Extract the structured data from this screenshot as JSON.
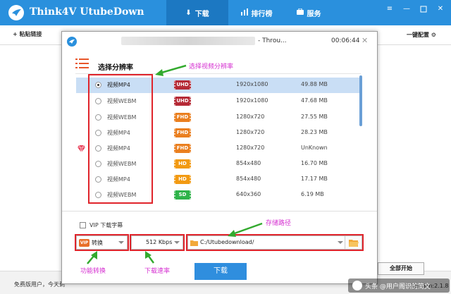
{
  "app": {
    "title": "Think4V UtubeDown"
  },
  "nav": {
    "tabs": [
      {
        "label": "下载",
        "icon": "download-arrow-icon",
        "active": true
      },
      {
        "label": "排行榜",
        "icon": "bar-chart-icon",
        "active": false
      },
      {
        "label": "服务",
        "icon": "briefcase-icon",
        "active": false
      }
    ]
  },
  "window_controls": {
    "menu": "≡",
    "minimize": "—",
    "close": "✕"
  },
  "main": {
    "paste_link": "+ 粘贴链接",
    "settings": "一键配置 ⚙",
    "free_user_text": "免费版用户，今天剩",
    "start_all": "全部开始",
    "version": "Version:2.1.8"
  },
  "dialog": {
    "title_suffix": "- Throu...",
    "duration": "00:06:44",
    "close": "✕",
    "section_title": "选择分辨率",
    "rows": [
      {
        "format": "视频MP4",
        "quality": "UHD",
        "resolution": "1920x1080",
        "size": "49.88 MB",
        "selected": true,
        "vip": false
      },
      {
        "format": "视频WEBM",
        "quality": "UHD",
        "resolution": "1920x1080",
        "size": "47.68 MB",
        "selected": false,
        "vip": false
      },
      {
        "format": "视频WEBM",
        "quality": "FHD",
        "resolution": "1280x720",
        "size": "27.55 MB",
        "selected": false,
        "vip": false
      },
      {
        "format": "视频MP4",
        "quality": "FHD",
        "resolution": "1280x720",
        "size": "28.23 MB",
        "selected": false,
        "vip": false
      },
      {
        "format": "视频MP4",
        "quality": "FHD",
        "resolution": "1280x720",
        "size": "UnKnown",
        "selected": false,
        "vip": true
      },
      {
        "format": "视频WEBM",
        "quality": "HD",
        "resolution": "854x480",
        "size": "16.70 MB",
        "selected": false,
        "vip": false
      },
      {
        "format": "视频MP4",
        "quality": "HD",
        "resolution": "854x480",
        "size": "17.17 MB",
        "selected": false,
        "vip": false
      },
      {
        "format": "视频WEBM",
        "quality": "SD",
        "resolution": "640x360",
        "size": "6.19 MB",
        "selected": false,
        "vip": false
      }
    ],
    "vip_subtitle_label": "VIP 下载字幕",
    "convert": {
      "vip_tag": "VIP",
      "label": "转换"
    },
    "speed": "512 Kbps",
    "path": "C:/Utubedownload/",
    "download_button": "下载"
  },
  "annotations": {
    "resolution": "选择视频分辨率",
    "path": "存储路径",
    "convert": "功能转换",
    "speed": "下载速率"
  },
  "watermark": {
    "text": "头条 @用户阁识的简文"
  },
  "colors": {
    "topbar": "#2a90dd",
    "UHD": "#b52a36",
    "FHD": "#ea7f1f",
    "HD": "#f29a12",
    "SD": "#2fb34a",
    "annotation": "#d52fd0",
    "highlight_box": "#e0242b",
    "arrow": "#33aa2e"
  }
}
